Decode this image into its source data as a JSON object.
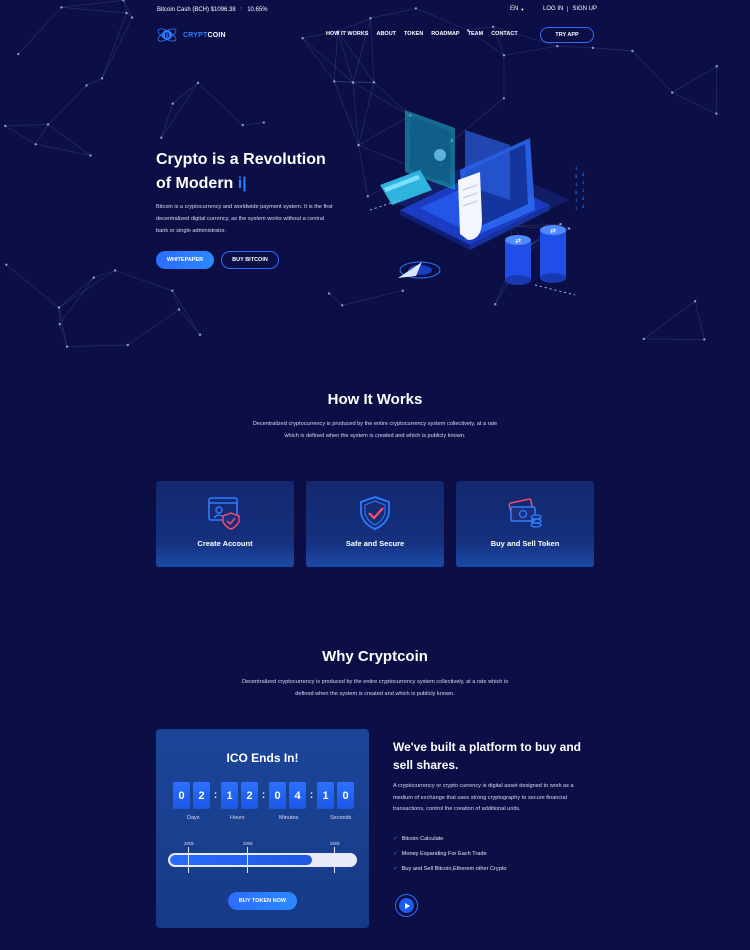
{
  "topbar": {
    "ticker_label": "Bitcoin Cash (BCH) $1096.38",
    "ticker_change": "10.65%",
    "lang": "EN",
    "login": "LOG IN",
    "signup": "SIGN UP"
  },
  "nav": {
    "logo_a": "CRYPT",
    "logo_b": "COIN",
    "items": [
      "HOW IT WORKS",
      "ABOUT",
      "TOKEN",
      "ROADMAP",
      "TEAM",
      "CONTACT"
    ],
    "try_app": "TRY APP"
  },
  "hero": {
    "title_line1": "Crypto is a Revolution",
    "title_line2": "of Modern ",
    "title_typed": "i|",
    "text": "Bitcoin is a cryptocurrency and worldwide payment system. It is the first decentralized digital currency, as the system works without a central bank or single administrator.",
    "btn_whitepaper": "WHITEPAPER",
    "btn_buy": "BUY BITCOIN"
  },
  "how": {
    "title": "How It Works",
    "text": "Decentralized cryptocurrency is produced by the entire cryptocurrency system collectively, at a rate which is defined when the system is created and which is publicly known.",
    "cards": [
      "Create Account",
      "Safe and Secure",
      "Buy and Sell Token"
    ]
  },
  "why": {
    "title": "Why Cryptcoin",
    "text": "Decentralized cryptocurrency is produced by the entire cryptocurrency system collectively, at a rate which is defined when the system is created and which is publicly known."
  },
  "ico": {
    "title": "ICO Ends In!",
    "digits": [
      "0",
      "2",
      "1",
      "2",
      "0",
      "4",
      "1",
      "0"
    ],
    "units": [
      "Days",
      "Hours",
      "Minutes",
      "Seconds"
    ],
    "ticks": [
      "200k",
      "200k",
      "200k"
    ],
    "progress": 0.77,
    "button": "BUY TOKEN NOW"
  },
  "platform": {
    "heading": "We've built a platform to buy and sell shares.",
    "text": "A cryptocurrency or crypto currency is digital asset designed to work as a medium of exchange that uses strong cryptography to secure financial transactions, control the creation of additional units.",
    "checks": [
      "Bitcoin Calculate",
      "Money Expanding For Each Trade",
      "Buy and Sell Bitcoin,Etherem other Crypto"
    ]
  },
  "colors": {
    "bg": "#0b0f45",
    "accent": "#2f7dff",
    "card": "#15307d"
  }
}
